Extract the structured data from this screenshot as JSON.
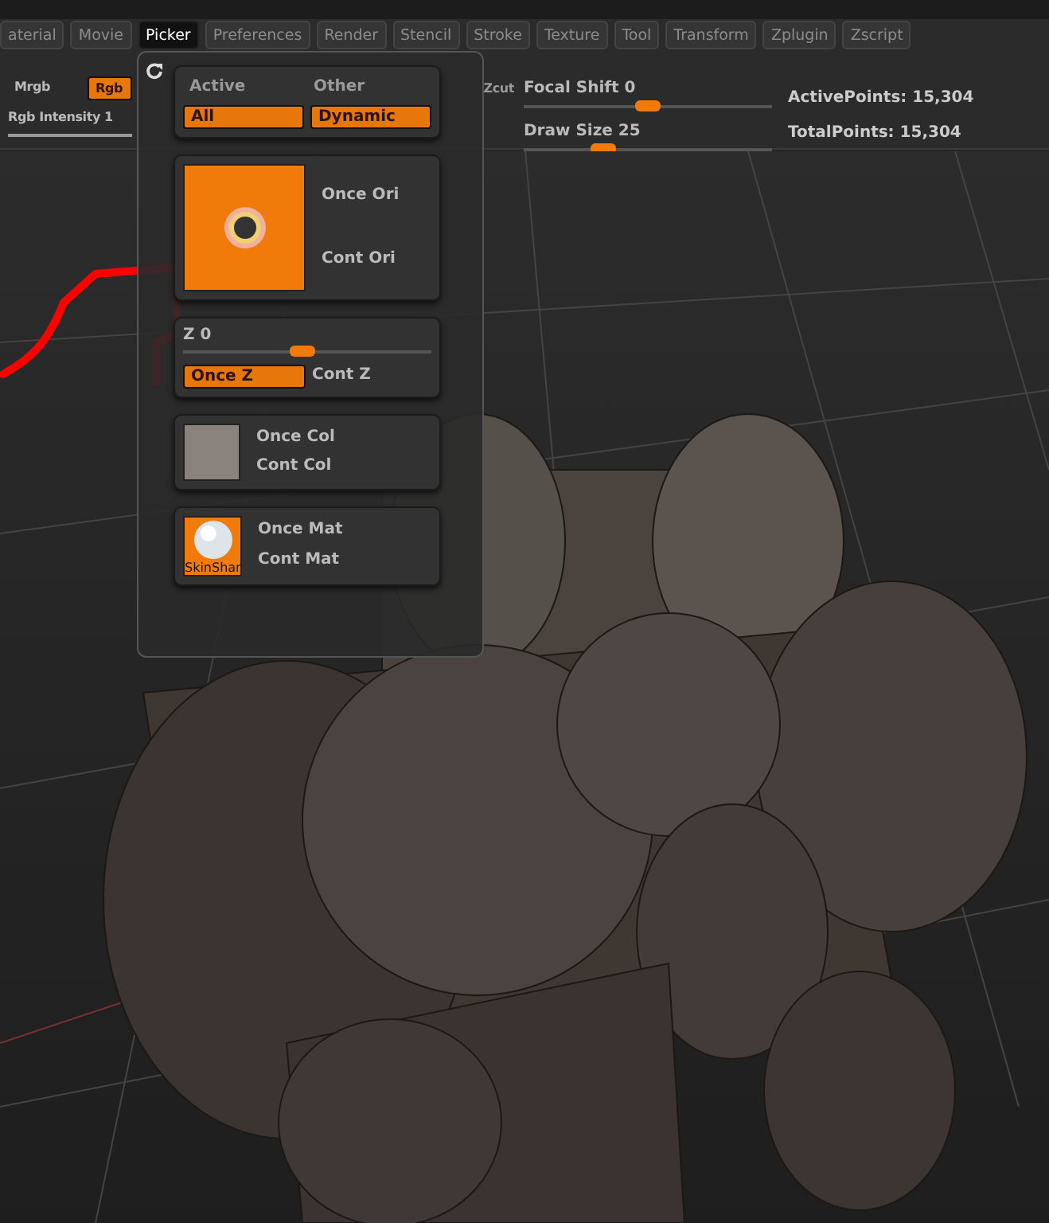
{
  "menu_tabs": [
    {
      "label": "aterial",
      "selected": false
    },
    {
      "label": "Movie",
      "selected": false
    },
    {
      "label": "Picker",
      "selected": true
    },
    {
      "label": "Preferences",
      "selected": false
    },
    {
      "label": "Render",
      "selected": false
    },
    {
      "label": "Stencil",
      "selected": false
    },
    {
      "label": "Stroke",
      "selected": false
    },
    {
      "label": "Texture",
      "selected": false
    },
    {
      "label": "Tool",
      "selected": false
    },
    {
      "label": "Transform",
      "selected": false
    },
    {
      "label": "Zplugin",
      "selected": false
    },
    {
      "label": "Zscript",
      "selected": false
    }
  ],
  "toolbar": {
    "mrgb": {
      "label": "Mrgb",
      "selected": false
    },
    "rgb": {
      "label": "Rgb",
      "selected": true
    },
    "rgb_intensity": {
      "label": "Rgb Intensity 1",
      "level": 1
    },
    "zcut": {
      "label": "Zcut"
    },
    "focal_shift": {
      "label": "Focal Shift 0",
      "level": 0.5
    },
    "draw_size": {
      "label": "Draw Size 25",
      "level": 0.32
    },
    "active_points": "ActivePoints: 15,304",
    "total_points": "TotalPoints: 15,304"
  },
  "picker": {
    "mode": {
      "headers": [
        "Active",
        "Other"
      ],
      "buttons": [
        {
          "label": "All",
          "selected": true
        },
        {
          "label": "Dynamic",
          "selected": true
        }
      ]
    },
    "orientation": {
      "options": [
        {
          "label": "Once Ori",
          "selected": false
        },
        {
          "label": "Cont Ori",
          "selected": false
        }
      ]
    },
    "z": {
      "label": "Z 0",
      "level": 0.48,
      "options": [
        {
          "label": "Once Z",
          "selected": true
        },
        {
          "label": "Cont Z",
          "selected": false
        }
      ]
    },
    "color": {
      "options": [
        {
          "label": "Once Col",
          "selected": false
        },
        {
          "label": "Cont Col",
          "selected": false
        }
      ]
    },
    "material": {
      "swatch_label": "SkinShar",
      "options": [
        {
          "label": "Once Mat",
          "selected": false
        },
        {
          "label": "Cont Mat",
          "selected": false
        }
      ]
    }
  }
}
